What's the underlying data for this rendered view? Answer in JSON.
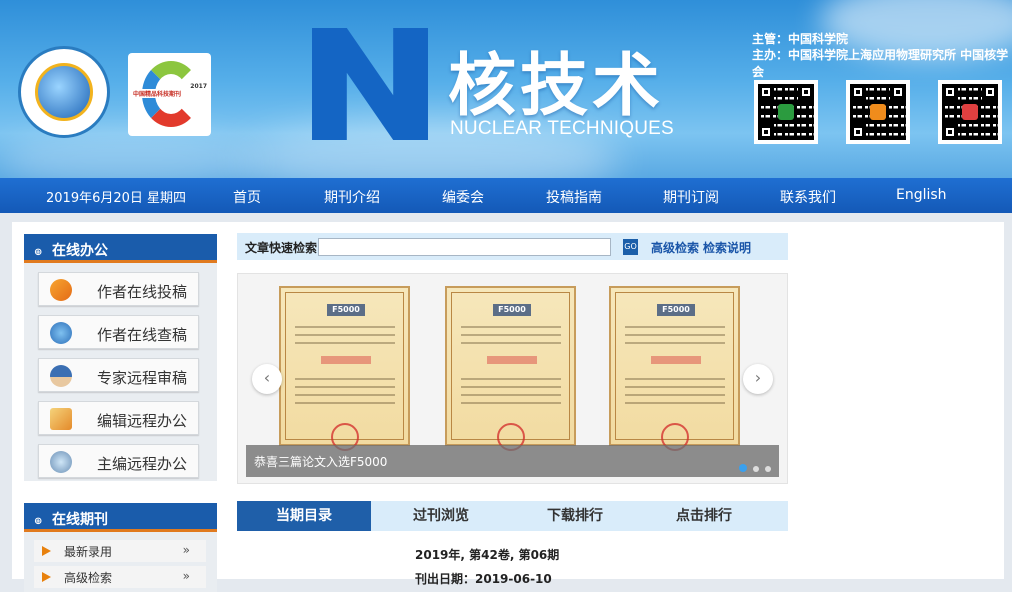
{
  "header": {
    "title": "核技术",
    "subtitle": "NUCLEAR TECHNIQUES",
    "supervisor": "主管：中国科学院",
    "sponsor": "主办：中国科学院上海应用物理研究所 中国核学会",
    "logo2_text": "中国精品科技期刊",
    "logo2_year": "2017",
    "qr_icons": [
      "wechat-qr-icon",
      "weibo-qr-icon",
      "microshop-qr-icon"
    ]
  },
  "nav": {
    "date": "2019年6月20日 星期四",
    "items": [
      "首页",
      "期刊介绍",
      "编委会",
      "投稿指南",
      "期刊订阅",
      "联系我们",
      "English"
    ]
  },
  "office": {
    "title": "在线办公",
    "buttons": [
      "作者在线投稿",
      "作者在线查稿",
      "专家远程审稿",
      "编辑远程办公",
      "主编远程办公"
    ]
  },
  "journal": {
    "title": "在线期刊",
    "items": [
      "最新录用",
      "高级检索"
    ],
    "arrow": "»"
  },
  "search": {
    "label": "文章快速检索",
    "value": "",
    "go": "GO",
    "advanced": "高级检索",
    "help": "检索说明"
  },
  "carousel": {
    "caption": "恭喜三篇论文入选F5000",
    "cert_badge": "F5000",
    "prev": "‹",
    "next": "›"
  },
  "tabs": [
    "当期目录",
    "过刊浏览",
    "下载排行",
    "点击排行"
  ],
  "issue": {
    "volume": "2019年, 第42卷, 第06期",
    "date": "刊出日期：2019-06-10"
  }
}
